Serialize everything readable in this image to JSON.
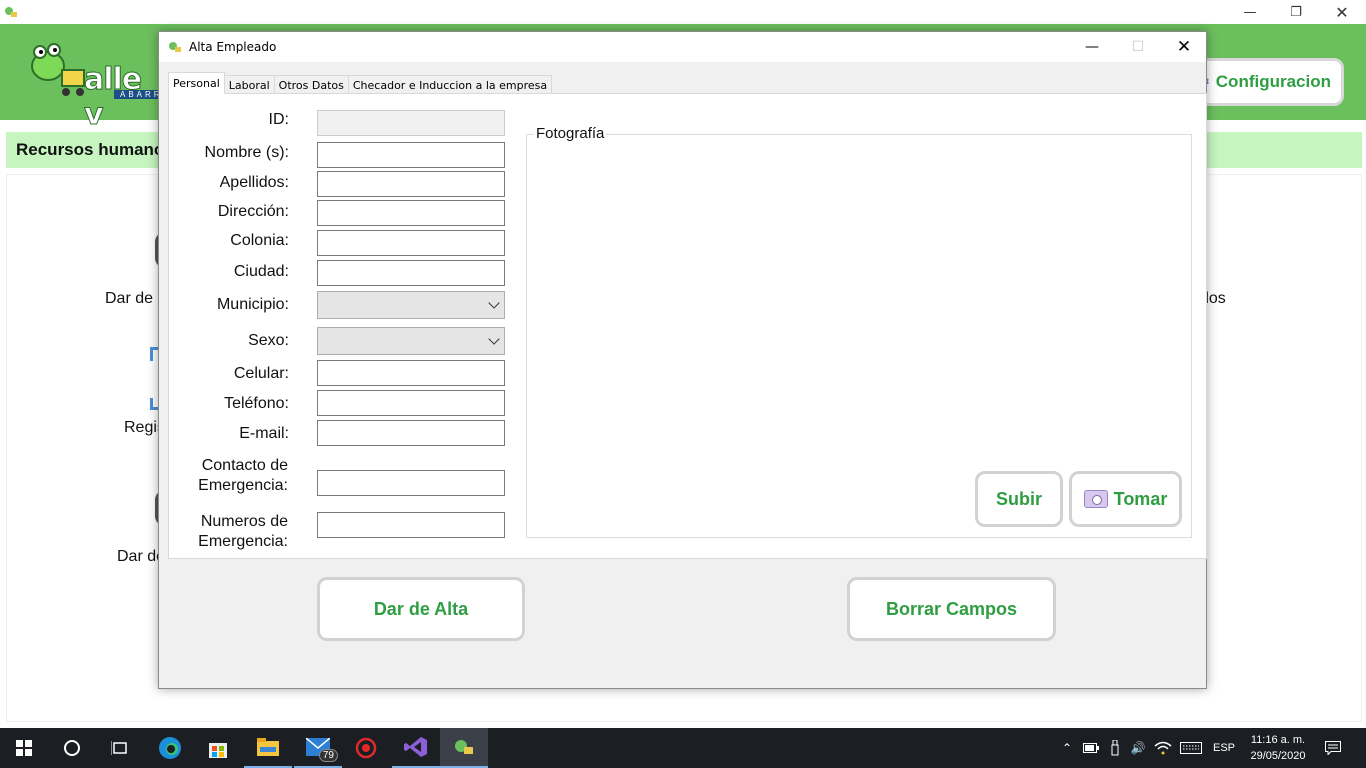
{
  "main_window": {
    "config_label": "Configuracion",
    "section_title": "Recursos humanos",
    "bg_labels": [
      "Dar de a",
      "Regis",
      "Dar de",
      "dos"
    ],
    "logo_text": "alle v",
    "logo_sub": "ABARR"
  },
  "dialog": {
    "title": "Alta Empleado",
    "tabs": [
      "Personal",
      "Laboral",
      "Otros Datos",
      "Checador e Induccion a la empresa"
    ],
    "fields": {
      "id": {
        "label": "ID:",
        "value": ""
      },
      "nombre": {
        "label": "Nombre (s):",
        "value": ""
      },
      "apellidos": {
        "label": "Apellidos:",
        "value": ""
      },
      "direccion": {
        "label": "Dirección:",
        "value": ""
      },
      "colonia": {
        "label": "Colonia:",
        "value": ""
      },
      "ciudad": {
        "label": "Ciudad:",
        "value": ""
      },
      "municipio": {
        "label": "Municipio:",
        "value": ""
      },
      "sexo": {
        "label": "Sexo:",
        "value": ""
      },
      "celular": {
        "label": "Celular:",
        "value": ""
      },
      "telefono": {
        "label": "Teléfono:",
        "value": ""
      },
      "email": {
        "label": "E-mail:",
        "value": ""
      },
      "contacto_1": {
        "label": "Contacto de",
        "value": ""
      },
      "contacto_2": {
        "label": "Emergencia:"
      },
      "numeros_1": {
        "label": "Numeros de",
        "value": ""
      },
      "numeros_2": {
        "label": "Emergencia:"
      }
    },
    "photo_group": "Fotografía",
    "subir_label": "Subir",
    "tomar_label": "Tomar",
    "alta_label": "Dar de Alta",
    "borrar_label": "Borrar Campos"
  },
  "taskbar": {
    "mail_badge": "79",
    "language": "ESP",
    "time": "11:16 a. m.",
    "date": "29/05/2020"
  },
  "colors": {
    "header_green": "#6cbf5d",
    "section_green": "#c6f5c0",
    "button_text_green": "#2f9e43",
    "taskbar": "#1b1f24"
  },
  "icons": [
    "frog-app-icon",
    "gear-icon",
    "camera-icon",
    "windows-start-icon",
    "search-circle-icon",
    "task-view-icon",
    "edge-icon",
    "store-icon",
    "file-explorer-icon",
    "mail-icon",
    "antivirus-icon",
    "visual-studio-icon",
    "chevron-up-icon",
    "battery-icon",
    "usb-icon",
    "volume-icon",
    "wifi-icon",
    "keyboard-icon",
    "notification-icon"
  ]
}
